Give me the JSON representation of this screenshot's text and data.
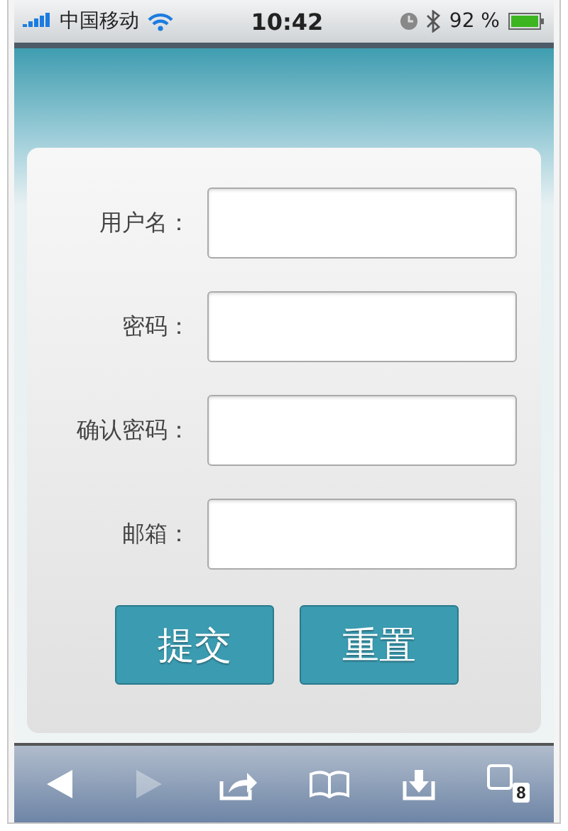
{
  "status_bar": {
    "carrier": "中国移动",
    "time": "10:42",
    "battery": "92 %"
  },
  "form": {
    "fields": [
      {
        "label": "用户名："
      },
      {
        "label": "密码："
      },
      {
        "label": "确认密码："
      },
      {
        "label": "邮箱："
      }
    ],
    "buttons": [
      "提交",
      "重置"
    ]
  },
  "toolbar": {
    "items": [
      {
        "kind": "back",
        "disabled": false
      },
      {
        "kind": "forward",
        "disabled": true
      },
      {
        "kind": "share",
        "disabled": false
      },
      {
        "kind": "bookmarks",
        "disabled": false
      },
      {
        "kind": "download",
        "disabled": false
      },
      {
        "kind": "tabs",
        "disabled": false,
        "count": "8"
      }
    ]
  }
}
